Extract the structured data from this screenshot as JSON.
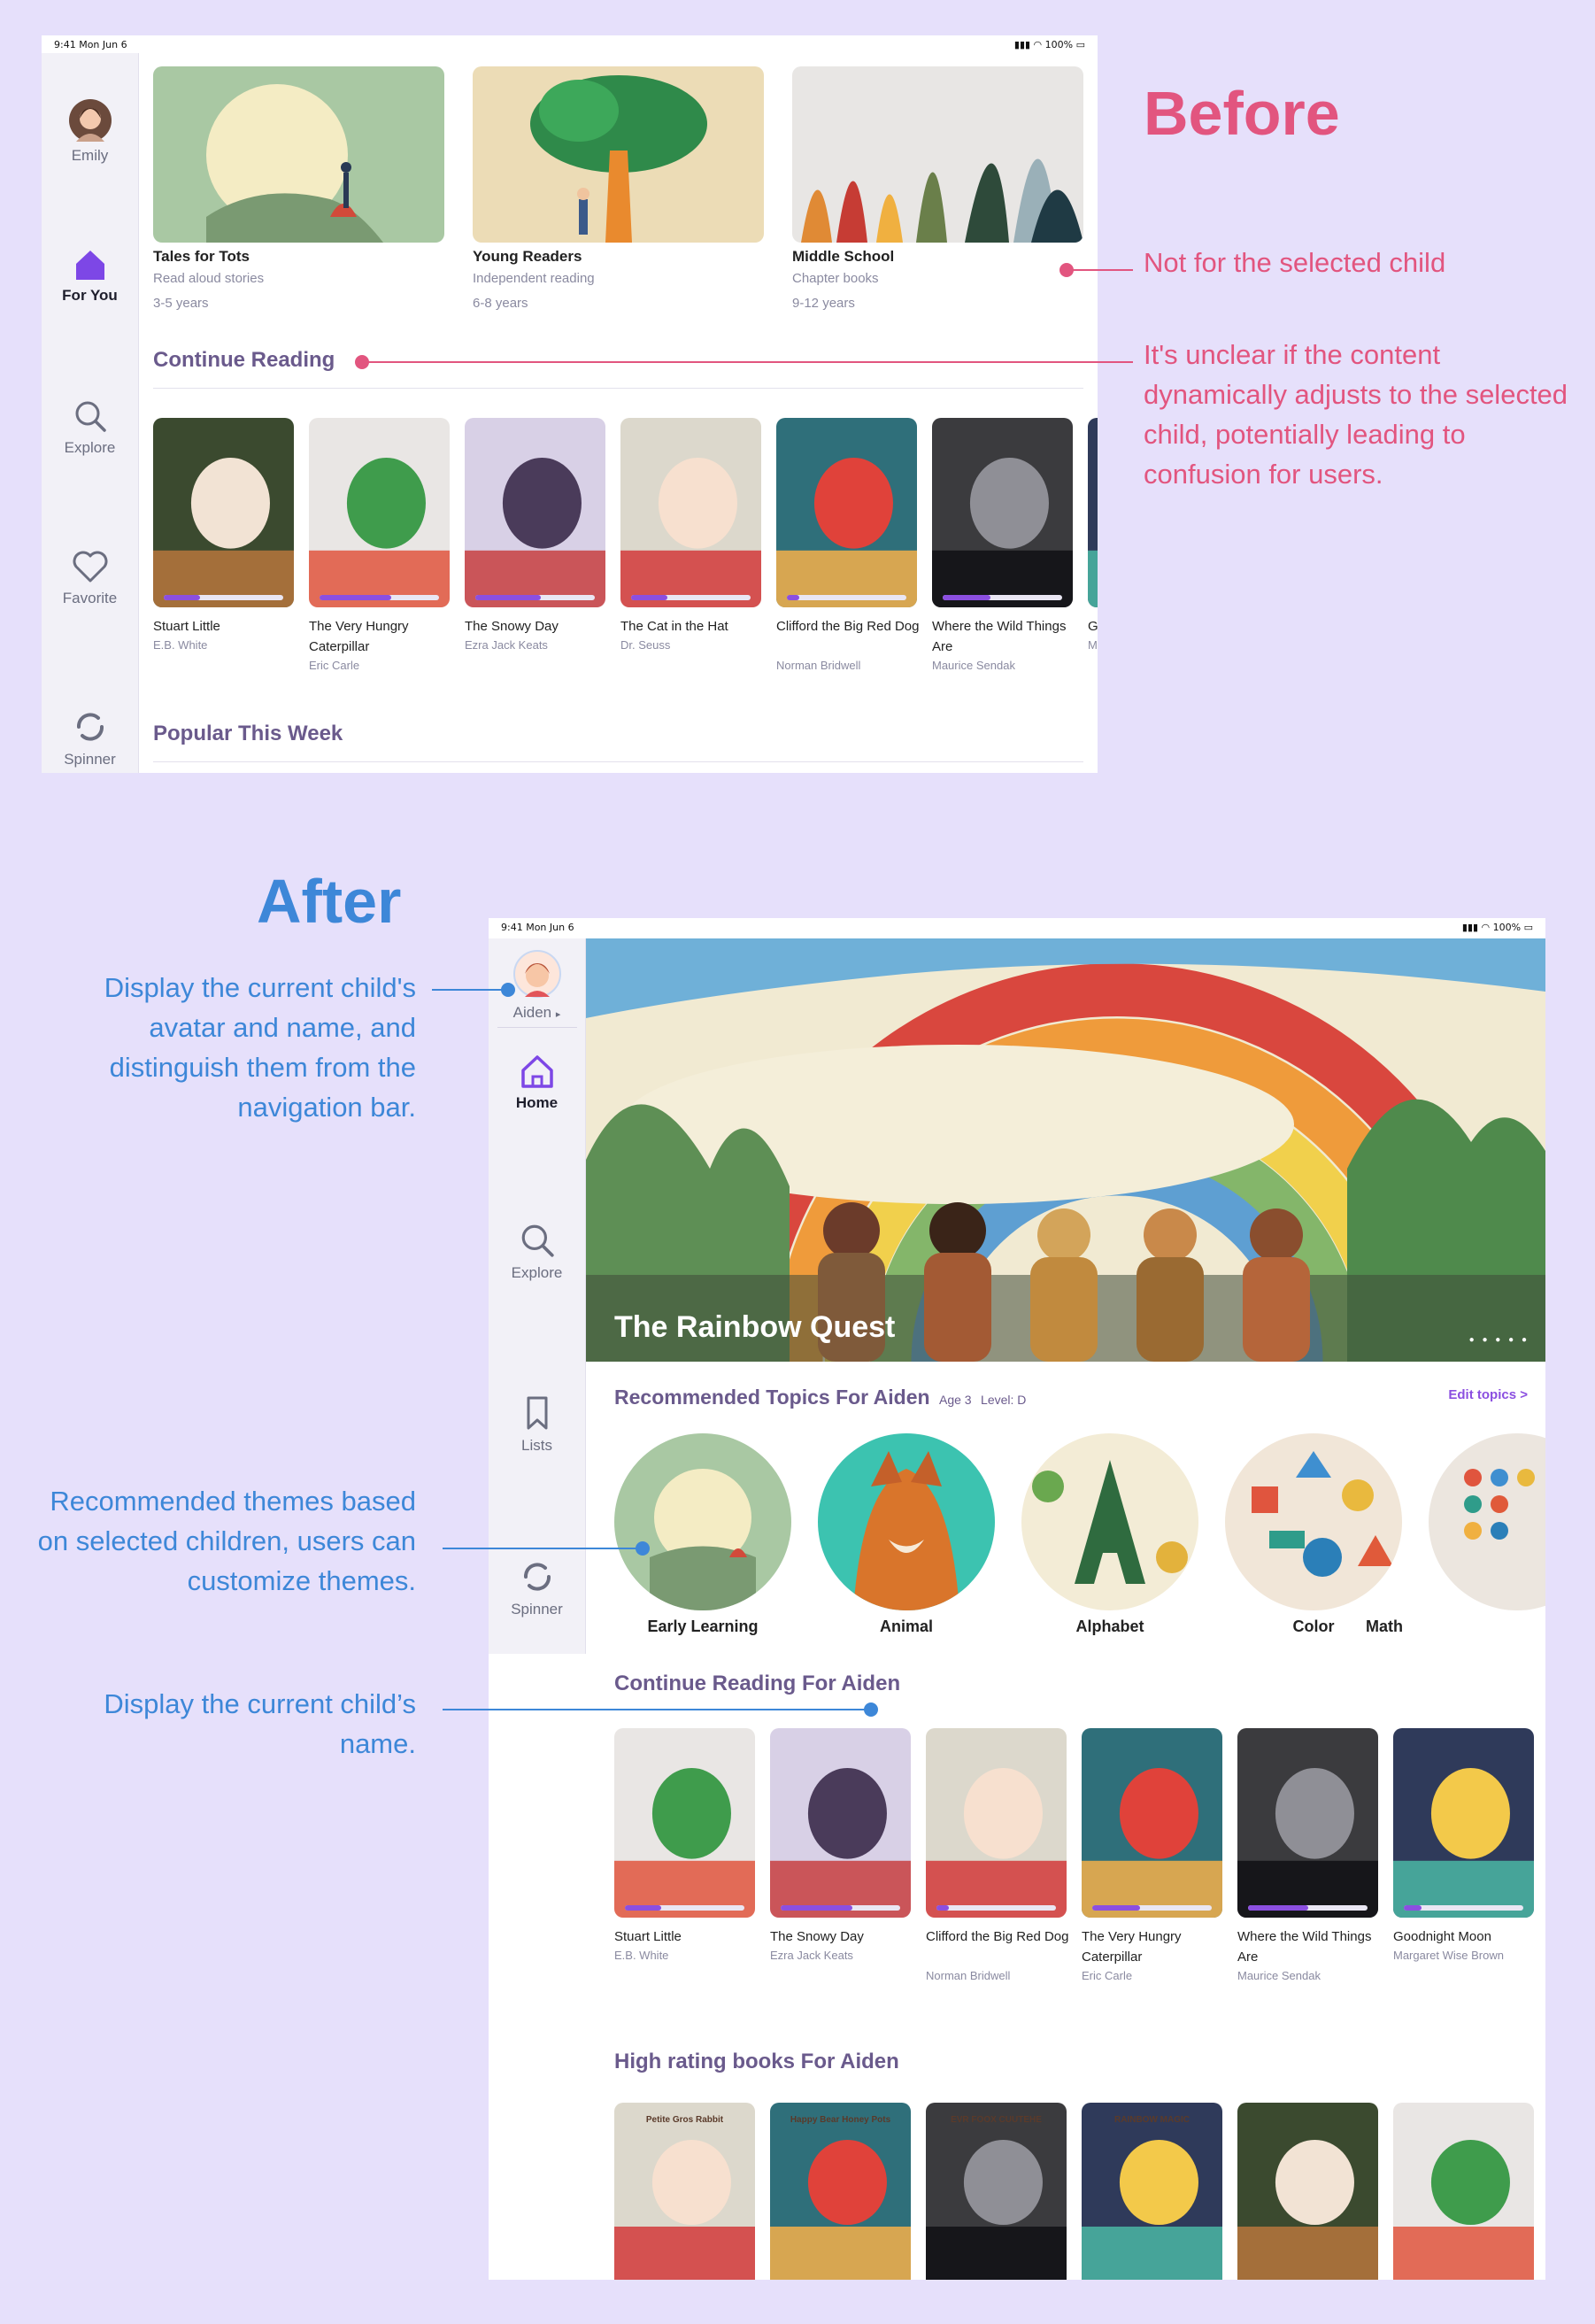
{
  "before": {
    "heading": "Before",
    "status": {
      "time": "9:41  Mon Jun 6",
      "right": "100%"
    },
    "sidebar": {
      "profile": "Emily",
      "items": [
        {
          "label": "For You",
          "icon": "home-icon",
          "active": true
        },
        {
          "label": "Explore",
          "icon": "search-icon",
          "active": false
        },
        {
          "label": "Favorite",
          "icon": "heart-icon",
          "active": false
        },
        {
          "label": "Spinner",
          "icon": "spinner-icon",
          "active": false
        }
      ]
    },
    "levels": [
      {
        "title": "Tales for Tots",
        "subtitle": "Read aloud stories",
        "age": "3-5 years"
      },
      {
        "title": "Young Readers",
        "subtitle": "Independent reading",
        "age": "6-8 years"
      },
      {
        "title": "Middle School",
        "subtitle": "Chapter books",
        "age": "9-12 years"
      }
    ],
    "continue_heading": "Continue Reading",
    "books": [
      {
        "title": "Stuart Little",
        "author": "E.B. White",
        "progress": 0.3
      },
      {
        "title": "The Very Hungry Caterpillar",
        "author": "Eric Carle",
        "progress": 0.6
      },
      {
        "title": "The Snowy Day",
        "author": "Ezra Jack Keats",
        "progress": 0.55
      },
      {
        "title": "The Cat in the Hat",
        "author": "Dr. Seuss",
        "progress": 0.3
      },
      {
        "title": "Clifford the Big Red Dog",
        "author": "Norman Bridwell",
        "progress": 0.1
      },
      {
        "title": "Where the Wild Things Are",
        "author": "Maurice Sendak",
        "progress": 0.4
      },
      {
        "title": "G",
        "author": "M",
        "progress": 0.2
      }
    ],
    "popular_heading": "Popular This Week",
    "notes": {
      "not_for_child": "Not for the selected child",
      "unclear": "It's unclear if the content dynamically adjusts to the selected child, potentially leading to confusion for users."
    }
  },
  "after": {
    "heading": "After",
    "status": {
      "time": "9:41  Mon Jun 6",
      "right": "100%"
    },
    "sidebar": {
      "profile": "Aiden",
      "profile_caret": "▸",
      "items": [
        {
          "label": "Home",
          "icon": "home-icon",
          "active": true
        },
        {
          "label": "Explore",
          "icon": "search-icon",
          "active": false
        },
        {
          "label": "Lists",
          "icon": "bookmark-icon",
          "active": false
        },
        {
          "label": "Spinner",
          "icon": "spinner-icon",
          "active": false
        }
      ]
    },
    "hero": {
      "title": "The Rainbow Quest"
    },
    "topics": {
      "heading": "Recommended Topics For Aiden",
      "age": "Age 3",
      "level": "Level: D",
      "edit": "Edit topics >",
      "items": [
        "Early Learning",
        "Animal",
        "Alphabet",
        "Color",
        "Math"
      ]
    },
    "continue": {
      "heading": "Continue Reading For Aiden",
      "books": [
        {
          "title": "Stuart Little",
          "author": "E.B. White",
          "progress": 0.3
        },
        {
          "title": "The Snowy Day",
          "author": "Ezra Jack Keats",
          "progress": 0.6
        },
        {
          "title": "Clifford the Big Red Dog",
          "author": "Norman Bridwell",
          "progress": 0.1
        },
        {
          "title": "The Very Hungry Caterpillar",
          "author": "Eric Carle",
          "progress": 0.4
        },
        {
          "title": "Where the Wild Things Are",
          "author": "Maurice Sendak",
          "progress": 0.5
        },
        {
          "title": "Goodnight Moon",
          "author": "Margaret Wise Brown",
          "progress": 0.15
        }
      ]
    },
    "high_rating": {
      "heading": "High rating books For Aiden",
      "covers": [
        "Petite Gros Rabbit",
        "Happy Bear Honey Pots",
        "EVR FOOX CUUTEHE",
        "RAINBOW MAGIC",
        "",
        ""
      ]
    },
    "notes": {
      "avatar": "Display the current child's avatar and name, and distinguish them from the navigation bar.",
      "themes": "Recommended themes based on selected children, users can customize themes.",
      "name": "Display the current child’s name."
    }
  }
}
